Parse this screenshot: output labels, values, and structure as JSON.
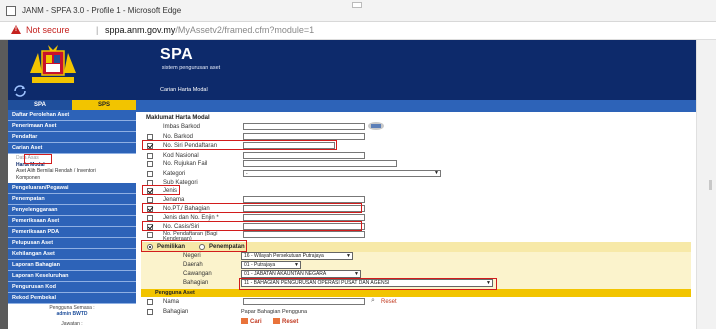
{
  "browser": {
    "title": "JANM - SPFA 3.0 - Profile 1 - Microsoft Edge",
    "security": "Not secure",
    "url_host": "sppa.anm.gov.my",
    "url_path": "/MyAssetv2/framed.cfm?module=1"
  },
  "header": {
    "app_name": "SPA",
    "subtitle": "sistem pengurusan aset",
    "breadcrumb": "Carian Harta Modal"
  },
  "sidebar": {
    "tabs": [
      "SPA",
      "SPS"
    ],
    "items_top": [
      "Daftar Perolehan Aset",
      "Penerimaan Aset",
      "Pendaftar"
    ],
    "carian_label": "Carian Aset",
    "carian_sub": [
      "Harta Modal",
      "Aset Alih Bernilai Rendah / Inventori",
      "Komponen"
    ],
    "carian_hidden": "Data Asas",
    "items_bottom": [
      "Pengeluaran/Pegawai",
      "Penempatan",
      "Penyelenggaraan",
      "Pemeriksaan Aset",
      "Pemeriksaan PDA",
      "Pelupusan Aset",
      "Kehilangan Aset",
      "Laporan Bahagian",
      "Laporan Keseluruhan",
      "Pengurusan Kod",
      "Rekod Pembekal"
    ],
    "footer_label": "Pengguna Semasa :",
    "footer_user": "admin BWTD",
    "footer_role": "Jawatan :"
  },
  "form": {
    "section_title": "Maklumat Harta Modal",
    "rows": [
      {
        "label": "Imbas Barkod",
        "checked": false
      },
      {
        "label": "No. Barkod",
        "checked": false
      },
      {
        "label": "No. Siri Pendaftaran",
        "checked": true
      },
      {
        "label": "Kod Nasional",
        "checked": false
      },
      {
        "label": "No. Rujukan Fail",
        "checked": false
      },
      {
        "label": "Kategori",
        "checked": false
      },
      {
        "label": "Sub Kategori",
        "checked": false
      },
      {
        "label": "Jenis",
        "checked": true
      },
      {
        "label": "Jenama",
        "checked": false
      },
      {
        "label": "No.PT./ Bahagian",
        "checked": true
      },
      {
        "label": "Jenis dan No. Enjin *",
        "checked": false
      },
      {
        "label": "No. Casis/Siri",
        "checked": true
      },
      {
        "label": "No. Pendaftaran (Bagi Kenderaan)",
        "checked": false
      }
    ],
    "kategori_value": "-",
    "radio_pemilikan": "Pemilikan",
    "radio_penempatan": "Penempatan",
    "ownership": [
      {
        "label": "Negeri",
        "value": "16 - Wilayah Persekutuan Putrajaya"
      },
      {
        "label": "Daerah",
        "value": "01 - Putrajaya"
      },
      {
        "label": "Cawangan",
        "value": "01 - JABATAN AKAUNTAN NEGARA"
      },
      {
        "label": "Bahagian",
        "value": "11 - BAHAGIAN PENGURUSAN OPERASI PUSAT DAN AGENSI"
      }
    ],
    "pengguna_title": "Pengguna Aset",
    "pengguna_nama": "Nama",
    "pengguna_bahagian": "Bahagian",
    "pengguna_bahagian_value": "Papar Bahagian Pengguna",
    "reset_small": "Reset",
    "cari": "Cari",
    "reset": "Reset"
  }
}
